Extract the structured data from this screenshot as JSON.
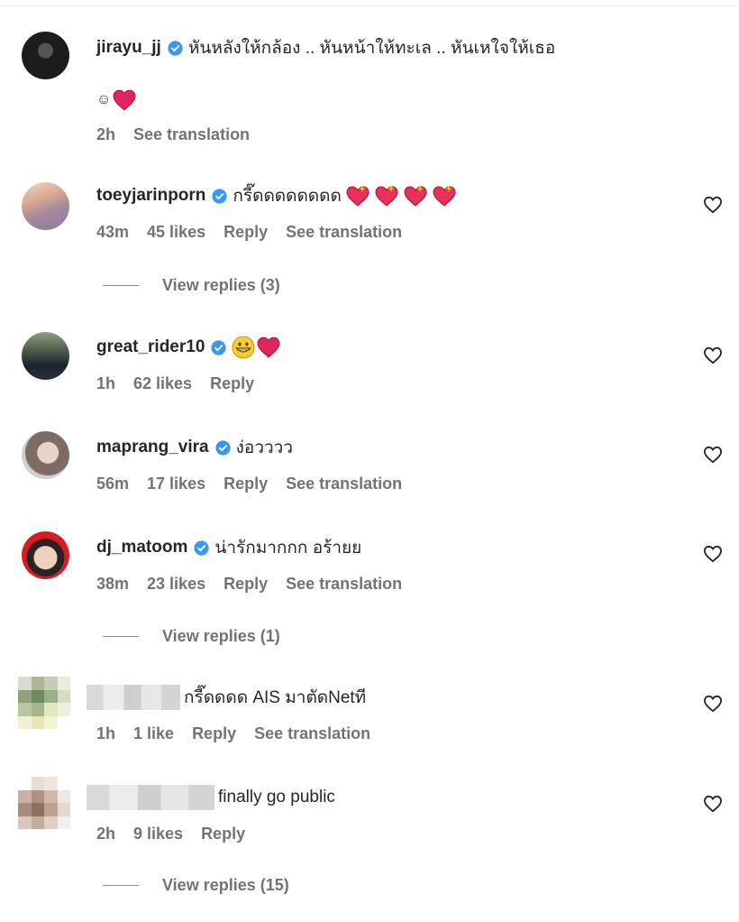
{
  "comments": [
    {
      "username": "jirayu_jj",
      "verified": true,
      "text": "หันหลังให้กล้อง .. หันหน้าให้ทะเล .. หันเหใจให้เธอ",
      "text_line2": "☺",
      "time": "2h",
      "translate": "See translation"
    },
    {
      "username": "toeyjarinporn",
      "verified": true,
      "text": "กรี๊ดดดดดดดด",
      "time": "43m",
      "likes": "45 likes",
      "reply": "Reply",
      "translate": "See translation",
      "view_replies": "View replies (3)"
    },
    {
      "username": "great_rider10",
      "verified": true,
      "text": "",
      "time": "1h",
      "likes": "62 likes",
      "reply": "Reply"
    },
    {
      "username": "maprang_vira",
      "verified": true,
      "text": "ง่อวววว",
      "time": "56m",
      "likes": "17 likes",
      "reply": "Reply",
      "translate": "See translation"
    },
    {
      "username": "dj_matoom",
      "verified": true,
      "text": "น่ารักมากกก อร้ายย",
      "time": "38m",
      "likes": "23 likes",
      "reply": "Reply",
      "translate": "See translation",
      "view_replies": "View replies (1)"
    },
    {
      "username": "",
      "verified": false,
      "text": "กรี๊ดดดด AIS มาตัดNetที",
      "time": "1h",
      "likes": "1 like",
      "reply": "Reply",
      "translate": "See translation"
    },
    {
      "username": "",
      "verified": false,
      "text": "finally go public",
      "time": "2h",
      "likes": "9 likes",
      "reply": "Reply",
      "view_replies": "View replies (15)"
    }
  ],
  "colors": {
    "verified_blue": "#3897f0",
    "emoji_red": "#e0245e",
    "meta_gray": "#737373"
  },
  "icons": {
    "like": "heart-outline-icon",
    "verified": "verified-badge-icon"
  }
}
